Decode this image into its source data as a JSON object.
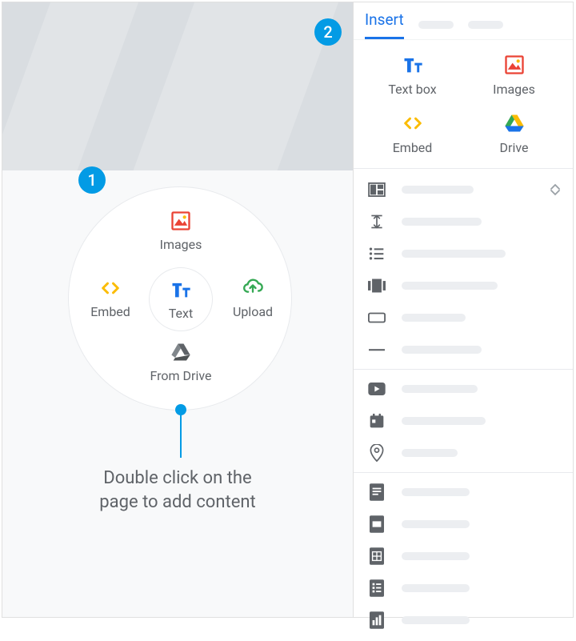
{
  "canvas": {
    "markers": {
      "one": "1",
      "two": "2"
    },
    "radial": {
      "center": "Text",
      "top": "Images",
      "right": "Upload",
      "bottom": "From Drive",
      "left": "Embed"
    },
    "hint_line1": "Double click on the",
    "hint_line2": "page to add content"
  },
  "panel": {
    "active_tab": "Insert",
    "tiles": {
      "textbox": "Text box",
      "images": "Images",
      "embed": "Embed",
      "drive": "Drive"
    },
    "list": [
      {
        "icon": "layout",
        "ph_width": 90,
        "stepper": true
      },
      {
        "icon": "collapsible",
        "ph_width": 100
      },
      {
        "icon": "toc",
        "ph_width": 130
      },
      {
        "icon": "carousel",
        "ph_width": 120
      },
      {
        "icon": "button",
        "ph_width": 80
      },
      {
        "icon": "divider",
        "ph_width": 100
      },
      {
        "divider": true
      },
      {
        "icon": "youtube",
        "ph_width": 95
      },
      {
        "icon": "calendar",
        "ph_width": 105
      },
      {
        "icon": "map",
        "ph_width": 70
      },
      {
        "divider": true
      },
      {
        "icon": "docs",
        "ph_width": 85
      },
      {
        "icon": "slides",
        "ph_width": 85
      },
      {
        "icon": "sheets",
        "ph_width": 85
      },
      {
        "icon": "forms",
        "ph_width": 85
      },
      {
        "icon": "charts",
        "ph_width": 85
      }
    ]
  },
  "colors": {
    "accent_blue": "#039be5",
    "panel_blue": "#1a73e8",
    "icon_red": "#ea4335",
    "icon_yellow": "#fbbc04",
    "icon_green": "#34a853",
    "icon_grey": "#5f6368"
  }
}
